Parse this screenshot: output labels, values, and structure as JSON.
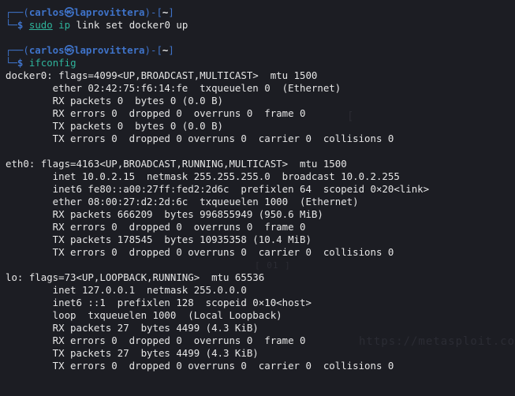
{
  "prompts": [
    {
      "frame_top": "┌──(",
      "user": "carlos",
      "at": "㉿",
      "host": "laprovittera",
      "frame_mid": ")-[",
      "dir": "~",
      "frame_end": "]",
      "frame_bottom": "└─",
      "dollar": "$",
      "cmd_first": "sudo",
      "cmd_second": "ip",
      "cmd_rest": " link set docker0 up"
    },
    {
      "frame_top": "┌──(",
      "user": "carlos",
      "at": "㉿",
      "host": "laprovittera",
      "frame_mid": ")-[",
      "dir": "~",
      "frame_end": "]",
      "frame_bottom": "└─",
      "dollar": "$",
      "cmd_first": "ifconfig",
      "cmd_second": "",
      "cmd_rest": ""
    }
  ],
  "output_lines": [
    "docker0: flags=4099<UP,BROADCAST,MULTICAST>  mtu 1500",
    "        ether 02:42:75:f6:14:fe  txqueuelen 0  (Ethernet)",
    "        RX packets 0  bytes 0 (0.0 B)",
    "        RX errors 0  dropped 0  overruns 0  frame 0",
    "        TX packets 0  bytes 0 (0.0 B)",
    "        TX errors 0  dropped 0 overruns 0  carrier 0  collisions 0",
    "",
    "eth0: flags=4163<UP,BROADCAST,RUNNING,MULTICAST>  mtu 1500",
    "        inet 10.0.2.15  netmask 255.255.255.0  broadcast 10.0.2.255",
    "        inet6 fe80::a00:27ff:fed2:2d6c  prefixlen 64  scopeid 0×20<link>",
    "        ether 08:00:27:d2:2d:6c  txqueuelen 1000  (Ethernet)",
    "        RX packets 666209  bytes 996855949 (950.6 MiB)",
    "        RX errors 0  dropped 0  overruns 0  frame 0",
    "        TX packets 178545  bytes 10935358 (10.4 MiB)",
    "        TX errors 0  dropped 0 overruns 0  carrier 0  collisions 0",
    "",
    "lo: flags=73<UP,LOOPBACK,RUNNING>  mtu 65536",
    "        inet 127.0.0.1  netmask 255.0.0.0",
    "        inet6 ::1  prefixlen 128  scopeid 0×10<host>",
    "        loop  txqueuelen 1000  (Local Loopback)",
    "        RX packets 27  bytes 4499 (4.3 KiB)",
    "        RX errors 0  dropped 0  overruns 0  frame 0",
    "        TX packets 27  bytes 4499 (4.3 KiB)",
    "        TX errors 0  dropped 0 overruns 0  carrier 0  collisions 0"
  ],
  "watermark": {
    "url": "https://metasploit.co",
    "note": "[ 01 ]",
    "bracket": "["
  },
  "colors": {
    "background": "#1c1d23",
    "prompt_blue": "#3f73c9",
    "command_green": "#2fb49b",
    "text": "#e6e6e6"
  }
}
